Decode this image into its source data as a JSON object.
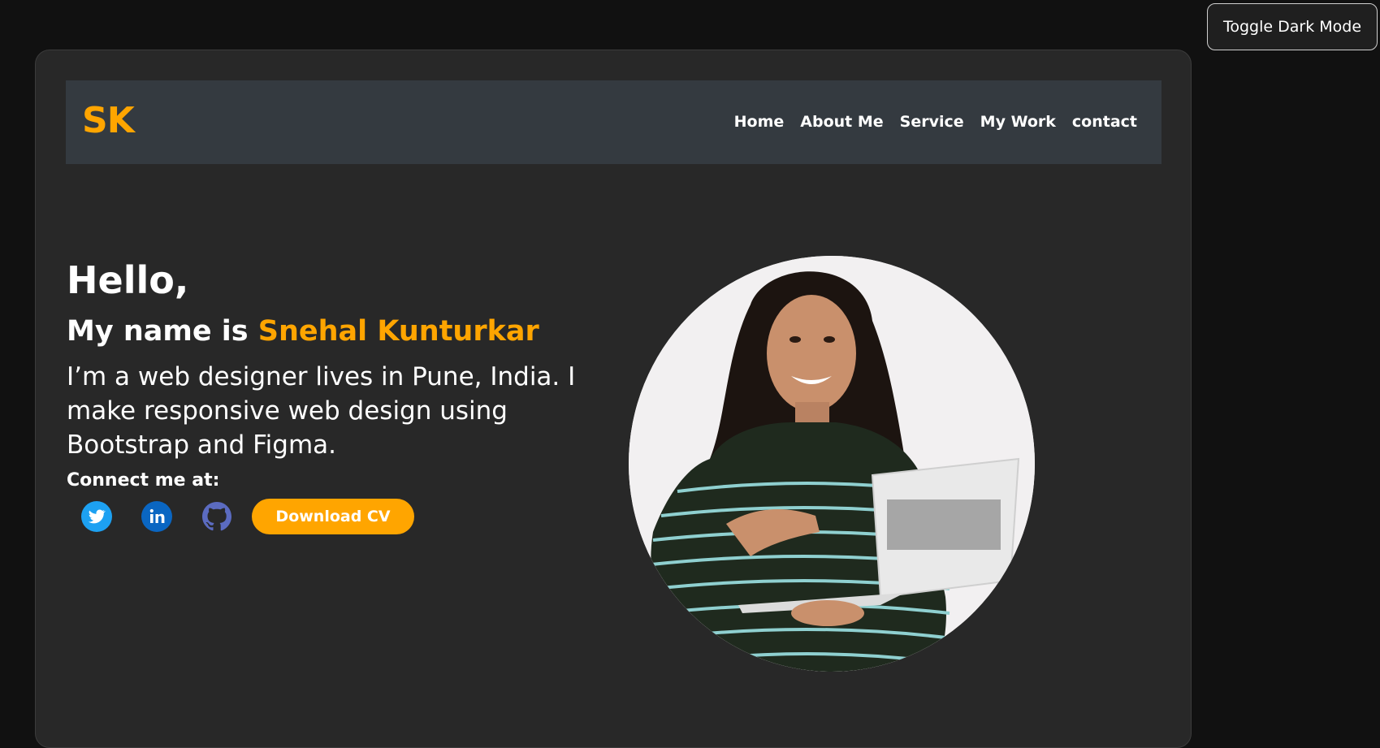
{
  "toggle": {
    "label": "Toggle Dark Mode"
  },
  "nav": {
    "logo": "SK",
    "links": [
      "Home",
      "About Me",
      "Service",
      "My Work",
      "contact"
    ]
  },
  "hero": {
    "hello": "Hello,",
    "name_prefix": "My name is ",
    "name": "Snehal Kunturkar",
    "description": "I’m a web designer lives in Pune, India. I make responsive web design using Bootstrap and Figma.",
    "connect": "Connect me at:",
    "download_label": "Download CV"
  },
  "socials": [
    {
      "icon": "twitter-icon",
      "color": "#1da1f2"
    },
    {
      "icon": "linkedin-icon",
      "color": "#0a66c2"
    },
    {
      "icon": "github-icon",
      "color": "#5b6bc0"
    }
  ],
  "colors": {
    "accent": "#ffa500",
    "navbar": "#343a40",
    "card": "#282828",
    "background": "#111111"
  }
}
